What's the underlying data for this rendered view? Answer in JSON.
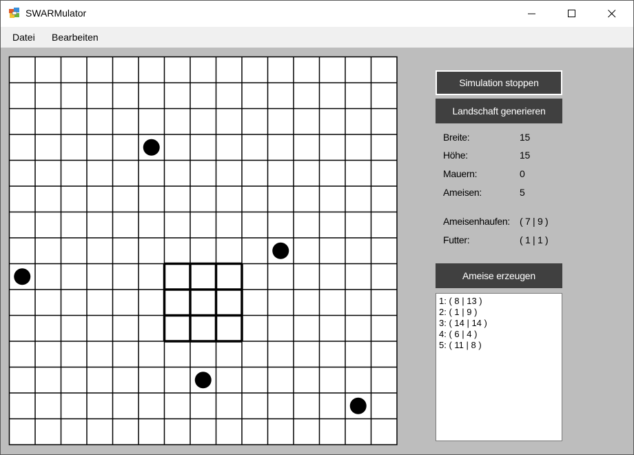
{
  "window": {
    "title": "SWARMulator"
  },
  "menu": [
    {
      "label": "Datei"
    },
    {
      "label": "Bearbeiten"
    }
  ],
  "buttons": {
    "stop_simulation": "Simulation stoppen",
    "generate_landscape": "Landschaft generieren",
    "create_ant": "Ameise erzeugen"
  },
  "info": {
    "width_label": "Breite:",
    "width_value": "15",
    "height_label": "Höhe:",
    "height_value": "15",
    "walls_label": "Mauern:",
    "walls_value": "0",
    "ants_label": "Ameisen:",
    "ants_value": "5",
    "anthill_label": "Ameisenhaufen:",
    "anthill_value": "( 7 | 9 )",
    "food_label": "Futter:",
    "food_value": "( 1 | 1 )"
  },
  "ant_list": [
    "1: ( 8 | 13 )",
    "2: ( 1 | 9 )",
    "3: ( 14 | 14 )",
    "4: ( 6 | 4 )",
    "5: ( 11 | 8 )"
  ],
  "grid": {
    "columns": 15,
    "rows": 15,
    "anthill_block": {
      "col_start": 6,
      "col_end": 9,
      "row_start": 8,
      "row_end": 11
    },
    "dots": [
      {
        "col": 5,
        "row": 3
      },
      {
        "col": 10,
        "row": 7
      },
      {
        "col": 0,
        "row": 8
      },
      {
        "col": 7,
        "row": 12
      },
      {
        "col": 13,
        "row": 13
      }
    ]
  }
}
